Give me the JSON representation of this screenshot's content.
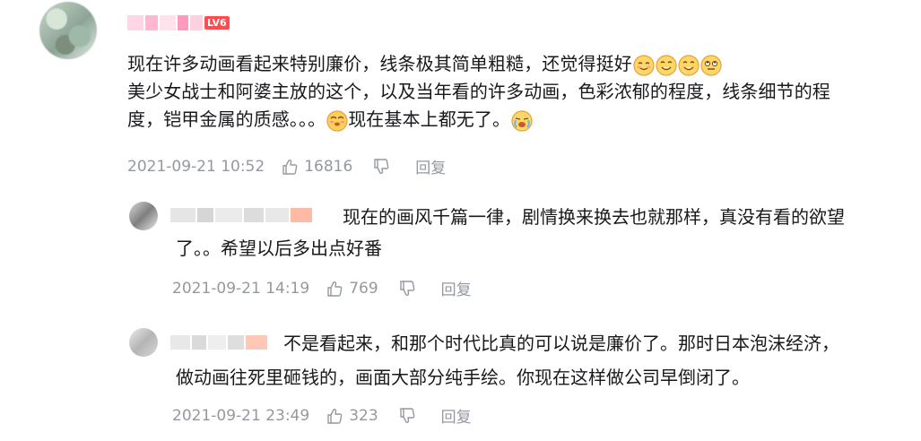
{
  "main_comment": {
    "level": "LV6",
    "text_line1": "现在许多动画看起来特别廉价，线条极其简单粗糙，还觉得挺好",
    "text_line2": "美少女战士和阿婆主放的这个，以及当年看的许多动画，色彩浓郁的程度，线条细节的程",
    "text_line3_a": "度，铠甲金属的质感。。。",
    "text_line3_b": "现在基本上都无了。",
    "time": "2021-09-21 10:52",
    "likes": "16816",
    "reply": "回复",
    "emojis": [
      "blush-emoji",
      "smile-emoji",
      "smile-emoji",
      "roll-eyes-emoji",
      "dizzy-emoji",
      "crying-emoji"
    ]
  },
  "replies": [
    {
      "text_line1": "现在的画风千篇一律，剧情换来换去也就那样，真没有看的欲望",
      "text_line2": "了。。希望以后多出点好番",
      "time": "2021-09-21 14:19",
      "likes": "769",
      "reply": "回复"
    },
    {
      "text_line1": "不是看起来，和那个时代比真的可以说是廉价了。那时日本泡沫经济，",
      "text_line2": "做动画往死里砸钱的，画面大部分纯手绘。你现在这样做公司早倒闭了。",
      "time": "2021-09-21 23:49",
      "likes": "323",
      "reply": "回复"
    }
  ],
  "colors": {
    "text": "#18191c",
    "meta": "#9499a0",
    "level_badge": "#ff4d4f"
  }
}
